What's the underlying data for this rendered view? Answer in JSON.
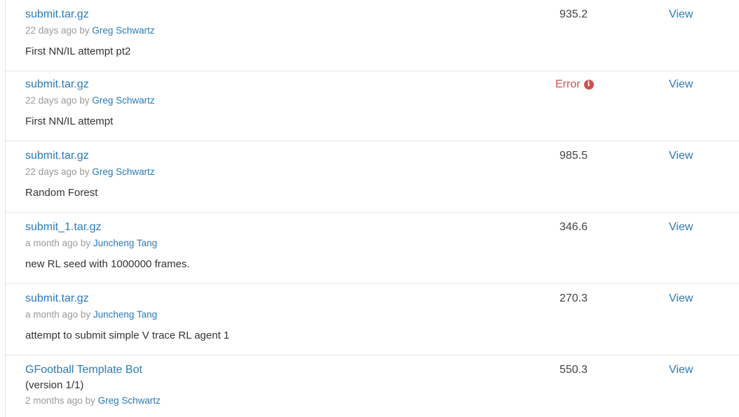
{
  "submissions": [
    {
      "title": "submit.tar.gz",
      "time": "22 days ago",
      "by": "by",
      "author": "Greg Schwartz",
      "description": "First NN/IL attempt pt2",
      "score": "935.2",
      "view_label": "View"
    },
    {
      "title": "submit.tar.gz",
      "time": "22 days ago",
      "by": "by",
      "author": "Greg Schwartz",
      "description": "First NN/IL attempt",
      "score": "Error",
      "error_icon": "info-circle-icon",
      "view_label": "View"
    },
    {
      "title": "submit.tar.gz",
      "time": "22 days ago",
      "by": "by",
      "author": "Greg Schwartz",
      "description": "Random Forest",
      "score": "985.5",
      "view_label": "View"
    },
    {
      "title": "submit_1.tar.gz",
      "time": "a month ago",
      "by": "by",
      "author": "Juncheng Tang",
      "description": "new RL seed with 1000000 frames.",
      "score": "346.6",
      "view_label": "View"
    },
    {
      "title": "submit.tar.gz",
      "time": "a month ago",
      "by": "by",
      "author": "Juncheng Tang",
      "description": "attempt to submit simple V trace RL agent 1",
      "score": "270.3",
      "view_label": "View"
    },
    {
      "title": "GFootball Template Bot",
      "version": "(version 1/1)",
      "time": "2 months ago",
      "by": "by",
      "author": "Greg Schwartz",
      "score": "550.3",
      "view_label": "View"
    }
  ],
  "colors": {
    "link": "#2a7ab8",
    "error": "#c9534f",
    "meta": "#9a9a9a",
    "text": "#333333"
  }
}
